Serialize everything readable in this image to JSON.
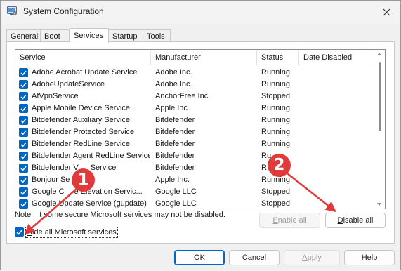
{
  "window": {
    "title": "System Configuration"
  },
  "tabs": [
    {
      "label": "General",
      "active": false
    },
    {
      "label": "Boot",
      "active": false
    },
    {
      "label": "Services",
      "active": true
    },
    {
      "label": "Startup",
      "active": false
    },
    {
      "label": "Tools",
      "active": false
    }
  ],
  "columns": {
    "service": "Service",
    "manufacturer": "Manufacturer",
    "status": "Status",
    "date_disabled": "Date Disabled"
  },
  "services": [
    {
      "name": "Adobe Acrobat Update Service",
      "manufacturer": "Adobe Inc.",
      "status": "Running",
      "checked": true
    },
    {
      "name": "AdobeUpdateService",
      "manufacturer": "Adobe Inc.",
      "status": "Running",
      "checked": true
    },
    {
      "name": "AfVpnService",
      "manufacturer": "AnchorFree Inc.",
      "status": "Stopped",
      "checked": true
    },
    {
      "name": "Apple Mobile Device Service",
      "manufacturer": "Apple Inc.",
      "status": "Running",
      "checked": true
    },
    {
      "name": "Bitdefender Auxiliary Service",
      "manufacturer": "Bitdefender",
      "status": "Running",
      "checked": true
    },
    {
      "name": "Bitdefender Protected Service",
      "manufacturer": "Bitdefender",
      "status": "Running",
      "checked": true
    },
    {
      "name": "Bitdefender RedLine Service",
      "manufacturer": "Bitdefender",
      "status": "Running",
      "checked": true
    },
    {
      "name": "Bitdefender Agent RedLine Service",
      "manufacturer": "Bitdefender",
      "status": "Ru",
      "checked": true
    },
    {
      "name": "Bitdefender V",
      "name_tail": " Service",
      "manufacturer": "Bitdefender",
      "status": "R",
      "checked": true
    },
    {
      "name": "Bonjour Se",
      "manufacturer": "Apple Inc.",
      "status": "Running",
      "checked": true
    },
    {
      "name": "Google C",
      "name_tail": "e Elevation Servic...",
      "manufacturer": "Google LLC",
      "status": "Stopped",
      "checked": true
    },
    {
      "name": "Google Update Service (gupdate)",
      "manufacturer": "Google LLC",
      "status": "Stopped",
      "checked": true
    }
  ],
  "note": {
    "prefix": "Note",
    "text": "t some secure Microsoft services may not be disabled."
  },
  "buttons": {
    "enable_all": {
      "accel": "E",
      "rest": "nable all"
    },
    "disable_all": {
      "accel": "D",
      "rest": "isable all"
    },
    "ok": "OK",
    "cancel": "Cancel",
    "apply": {
      "accel": "A",
      "rest": "pply"
    },
    "help": "Help"
  },
  "hide_ms": {
    "accel": "H",
    "rest": "ide all Microsoft services",
    "checked": true
  },
  "annotations": [
    {
      "label": "1"
    },
    {
      "label": "2"
    }
  ],
  "colors": {
    "accent": "#0067c0",
    "annotation": "#e03a3a"
  }
}
